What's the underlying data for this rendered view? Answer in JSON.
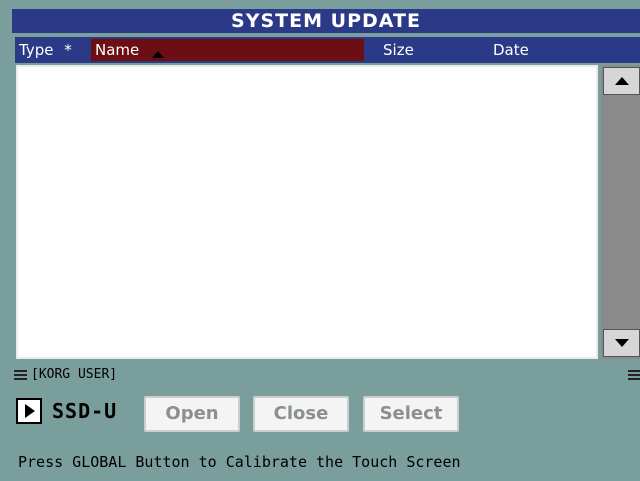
{
  "window": {
    "title": "SYSTEM UPDATE"
  },
  "file_list": {
    "columns": {
      "type": "Type",
      "type_marker": "*",
      "name": "Name",
      "size": "Size",
      "date": "Date"
    },
    "sorted_by": "Name",
    "rows": []
  },
  "path": {
    "label": "[KORG USER]"
  },
  "device": {
    "label": "SSD-U"
  },
  "buttons": {
    "open": "Open",
    "close": "Close",
    "select": "Select"
  },
  "status": {
    "message": "Press GLOBAL Button to Calibrate the Touch Screen"
  },
  "colors": {
    "background": "#7a9e9b",
    "title_bar": "#2b3a86",
    "sorted_column": "#6b0f14"
  }
}
